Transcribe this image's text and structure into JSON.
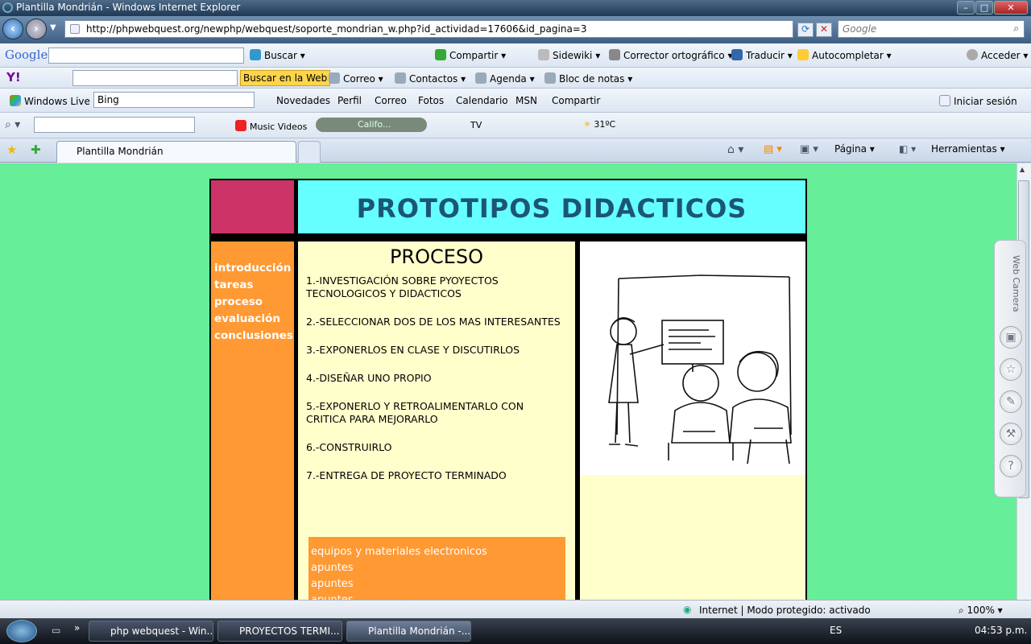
{
  "window": {
    "title": "Plantilla Mondrián - Windows Internet Explorer",
    "min": "–",
    "max": "□",
    "close": "✕"
  },
  "address": {
    "url": "http://phpwebquest.org/newphp/webquest/soporte_mondrian_w.php?id_actividad=17606&id_pagina=3",
    "search_placeholder": "Google"
  },
  "google_bar": {
    "brand": "Google",
    "items": [
      "Buscar",
      "Compartir",
      "Sidewiki",
      "Corrector ortográfico",
      "Traducir",
      "Autocompletar",
      "Acceder"
    ]
  },
  "yahoo_bar": {
    "brand": "Y!",
    "search_button": "Buscar en la Web",
    "items": [
      "Correo",
      "Contactos",
      "Agenda",
      "Bloc de notas"
    ]
  },
  "live_bar": {
    "brand": "Windows Live",
    "search_value": "Bing",
    "items": [
      "Novedades",
      "Perfil",
      "Correo",
      "Fotos",
      "Calendario",
      "MSN",
      "Compartir"
    ],
    "signin": "Iniciar sesión"
  },
  "media_bar": {
    "music": "Music Videos",
    "station": "Califo...",
    "tv": "TV",
    "weather": "31ºC"
  },
  "tabs": {
    "active": "Plantilla Mondrián",
    "page_menu": "Página",
    "tools_menu": "Herramientas"
  },
  "page": {
    "header": "PROTOTIPOS DIDACTICOS",
    "menu": [
      "introducción",
      "tareas",
      "proceso",
      "evaluación",
      "conclusiones"
    ],
    "section_title": "PROCESO",
    "steps": [
      "1.-INVESTIGACIÓN SOBRE PYOYECTOS TECNOLOGICOS Y DIDACTICOS",
      "2.-SELECCIONAR DOS DE LOS MAS INTERESANTES",
      "3.-EXPONERLOS EN CLASE Y DISCUTIRLOS",
      "4.-DISEÑAR UNO PROPIO",
      "5.-EXPONERLO Y RETROALIMENTARLO CON CRITICA PARA MEJORARLO",
      "6.-CONSTRUIRLO",
      "7.-ENTREGA DE PROYECTO TERMINADO"
    ],
    "resources": [
      "equipos y materiales electronicos",
      "apuntes",
      "apuntes",
      "apuntes"
    ]
  },
  "gadget": {
    "label": "Web Camera"
  },
  "status": {
    "zone": "Internet | Modo protegido: activado",
    "zoom": "100%"
  },
  "taskbar": {
    "tasks": [
      "php webquest - Win...",
      "PROYECTOS TERMI...",
      "Plantilla Mondrián -..."
    ],
    "lang": "ES",
    "time": "04:53 p.m."
  },
  "colors": {
    "page_bg": "#66ee99",
    "header_bg": "#66ffff",
    "header_text": "#1b5577",
    "accent_red": "#cc3366",
    "menu_bg": "#ff9933",
    "panel_bg": "#ffffcc"
  }
}
